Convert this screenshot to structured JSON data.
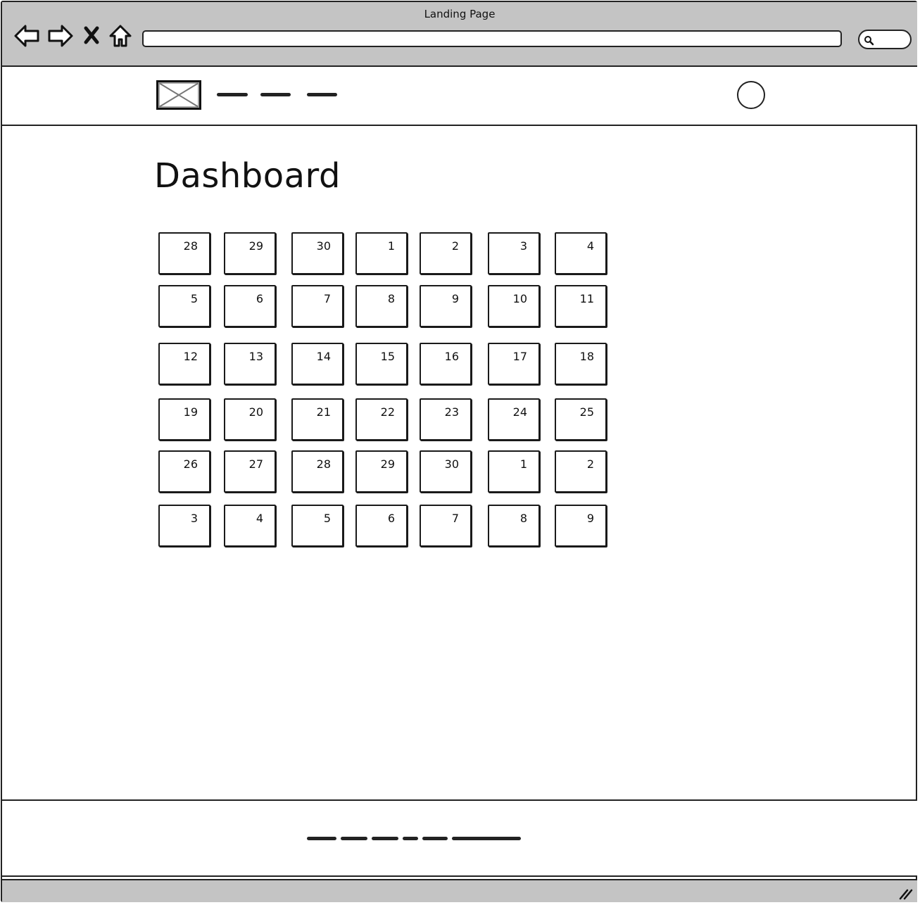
{
  "window": {
    "title": "Landing Page"
  },
  "browser": {
    "url_value": "",
    "search_value": "",
    "icons": [
      "back-arrow-icon",
      "forward-arrow-icon",
      "stop-icon",
      "home-icon",
      "search-icon"
    ]
  },
  "header": {
    "logo_icon": "image-placeholder-icon",
    "nav_links": [
      "placeholder-text",
      "placeholder-text",
      "placeholder-text"
    ],
    "avatar_icon": "user-avatar-circle-icon"
  },
  "main": {
    "title": "Dashboard",
    "calendar": {
      "rows": [
        [
          "28",
          "29",
          "30",
          "1",
          "2",
          "3",
          "4"
        ],
        [
          "5",
          "6",
          "7",
          "8",
          "9",
          "10",
          "11"
        ],
        [
          "12",
          "13",
          "14",
          "15",
          "16",
          "17",
          "18"
        ],
        [
          "19",
          "20",
          "21",
          "22",
          "23",
          "24",
          "25"
        ],
        [
          "26",
          "27",
          "28",
          "29",
          "30",
          "1",
          "2"
        ],
        [
          "3",
          "4",
          "5",
          "6",
          "7",
          "8",
          "9"
        ]
      ]
    }
  },
  "footer": {
    "text_icon": "placeholder-text"
  },
  "statusbar": {
    "grip_icon": "resize-grip-icon"
  }
}
